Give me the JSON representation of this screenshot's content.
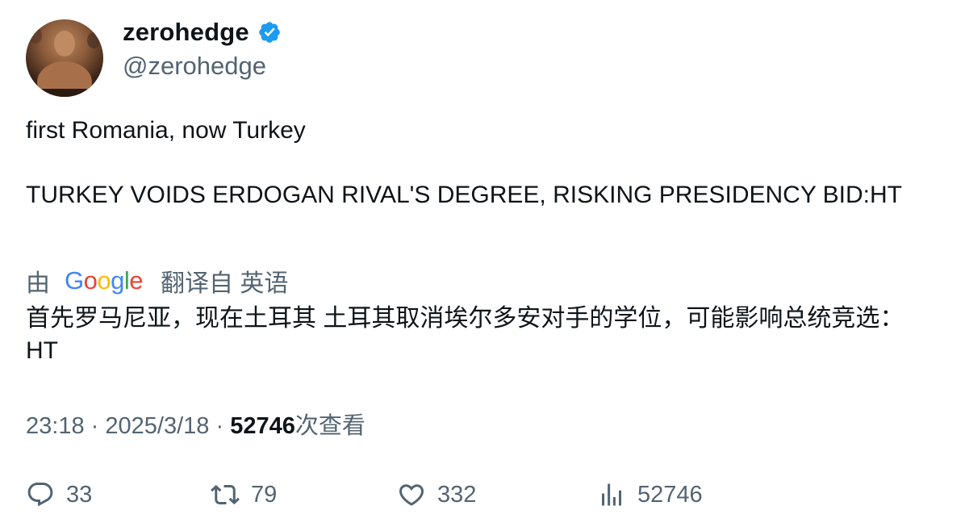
{
  "author": {
    "display_name": "zerohedge",
    "handle": "@zerohedge",
    "verified": true,
    "verified_color": "#1d9bf0"
  },
  "tweet": {
    "lines": [
      "first Romania, now Turkey",
      "TURKEY VOIDS ERDOGAN RIVAL'S DEGREE, RISKING PRESIDENCY BID:HT"
    ]
  },
  "translation": {
    "prefix": "由",
    "provider": "Google",
    "suffix": "翻译自 英语",
    "text": "首先罗马尼亚，现在土耳其 土耳其取消埃尔多安对手的学位，可能影响总统竞选：HT"
  },
  "meta": {
    "time": "23:18",
    "separator": "·",
    "date": "2025/3/18",
    "views_count": "52746",
    "views_label": "次查看"
  },
  "actions": {
    "replies": "33",
    "retweets": "79",
    "likes": "332",
    "views": "52746"
  },
  "colors": {
    "text_primary": "#0f1419",
    "text_secondary": "#536471"
  },
  "icons": [
    "verified-badge-icon",
    "reply-icon",
    "retweet-icon",
    "like-icon",
    "views-icon"
  ]
}
